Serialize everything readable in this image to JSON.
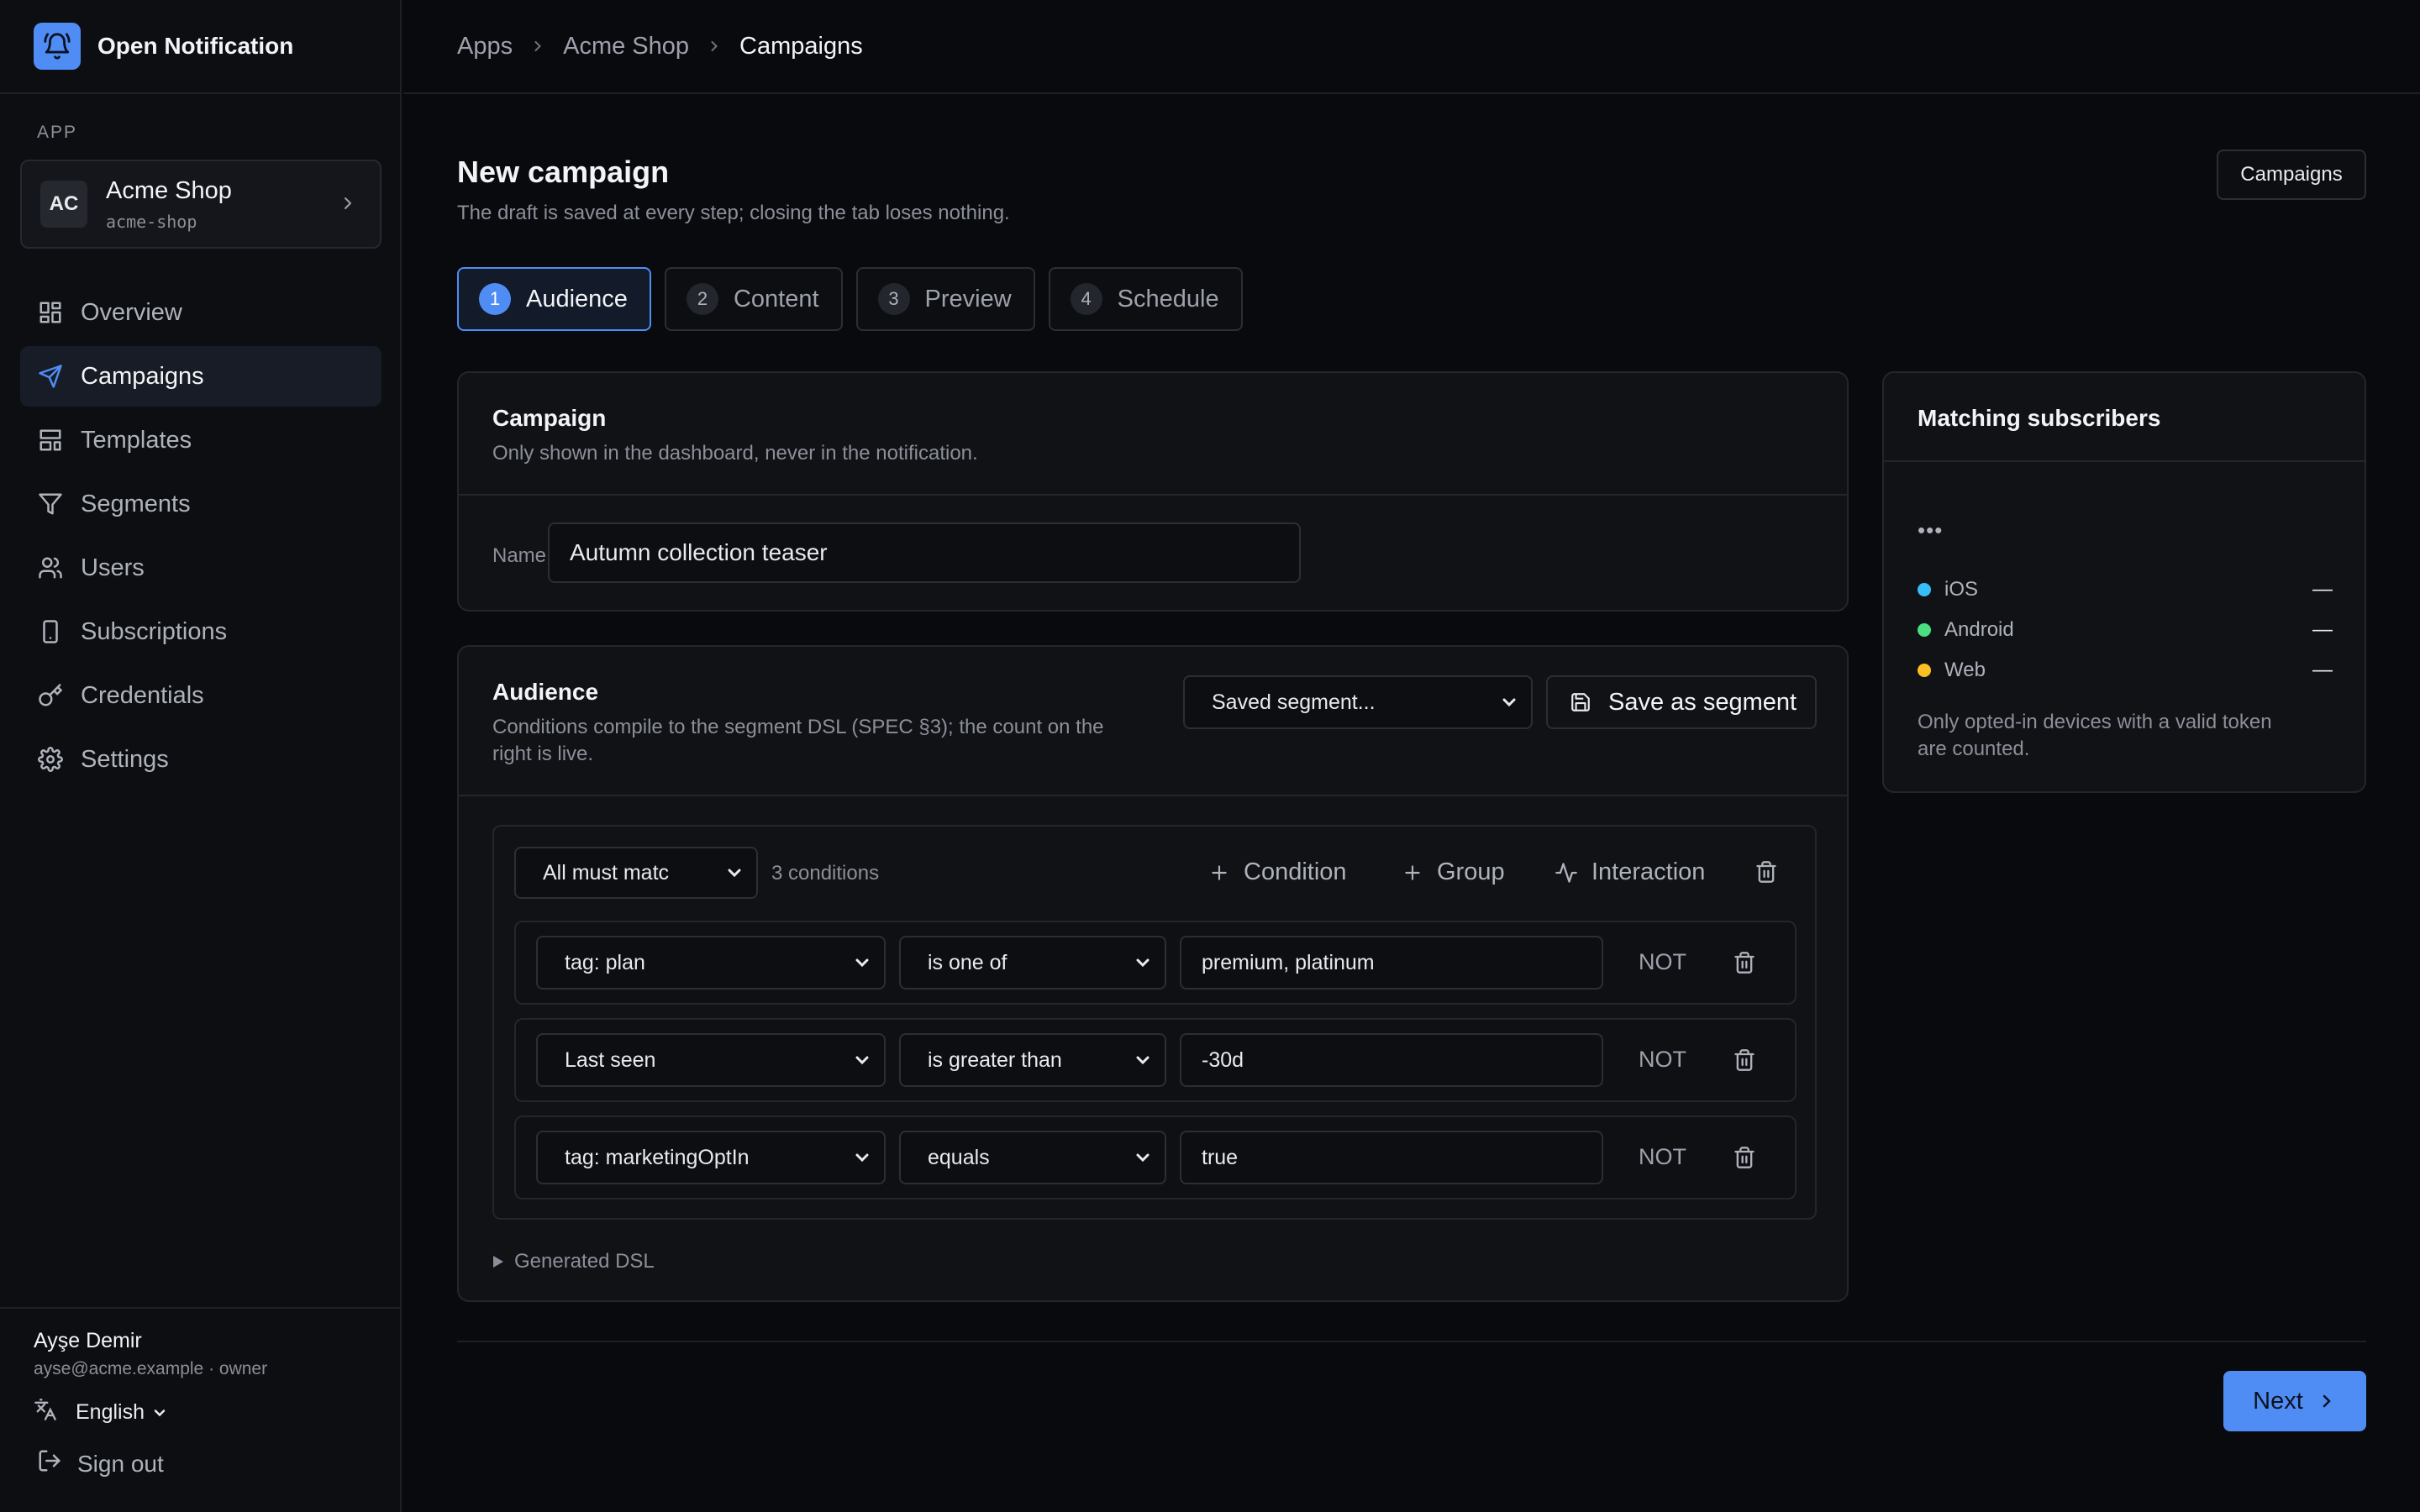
{
  "brand": {
    "name": "Open Notification",
    "icon": "bell-icon"
  },
  "sidebar": {
    "section_label": "APP",
    "app": {
      "initials": "AC",
      "name": "Acme Shop",
      "slug": "acme-shop"
    },
    "items": [
      {
        "label": "Overview",
        "icon": "grid-icon"
      },
      {
        "label": "Campaigns",
        "icon": "send-icon",
        "active": true
      },
      {
        "label": "Templates",
        "icon": "layout-icon"
      },
      {
        "label": "Segments",
        "icon": "filter-icon"
      },
      {
        "label": "Users",
        "icon": "users-icon"
      },
      {
        "label": "Subscriptions",
        "icon": "device-icon"
      },
      {
        "label": "Credentials",
        "icon": "key-icon"
      },
      {
        "label": "Settings",
        "icon": "gear-icon"
      }
    ],
    "user": {
      "name": "Ayşe Demir",
      "meta": "ayse@acme.example · owner"
    },
    "language": "English",
    "signout": "Sign out"
  },
  "breadcrumb": [
    "Apps",
    "Acme Shop",
    "Campaigns"
  ],
  "page": {
    "title": "New campaign",
    "subtitle": "The draft is saved at every step; closing the tab loses nothing.",
    "campaigns_button": "Campaigns"
  },
  "steps": [
    {
      "num": "1",
      "label": "Audience",
      "active": true
    },
    {
      "num": "2",
      "label": "Content"
    },
    {
      "num": "3",
      "label": "Preview"
    },
    {
      "num": "4",
      "label": "Schedule"
    }
  ],
  "campaign_card": {
    "title": "Campaign",
    "subtitle": "Only shown in the dashboard, never in the notification.",
    "name_label": "Name",
    "name_value": "Autumn collection teaser"
  },
  "audience_card": {
    "title": "Audience",
    "subtitle_line1": "Conditions compile to the segment DSL (SPEC §3); the count on the",
    "subtitle_line2": "right is live.",
    "saved_segment": "Saved segment...",
    "save_as_segment": "Save as segment",
    "group": {
      "match": "All must matc",
      "count": "3 conditions",
      "add_condition": "Condition",
      "add_group": "Group",
      "add_interaction": "Interaction"
    },
    "conditions": [
      {
        "field": "tag: plan",
        "operator": "is one of",
        "value": "premium, platinum",
        "not": "NOT"
      },
      {
        "field": "Last seen",
        "operator": "is greater than",
        "value": "-30d",
        "not": "NOT"
      },
      {
        "field": "tag: marketingOptIn",
        "operator": "equals",
        "value": "true",
        "not": "NOT"
      }
    ],
    "dsl_toggle": "Generated DSL"
  },
  "matching": {
    "title": "Matching subscribers",
    "loading": "•••",
    "platforms": [
      {
        "name": "iOS",
        "value": "—",
        "color": "#38bdf8"
      },
      {
        "name": "Android",
        "value": "—",
        "color": "#4ade80"
      },
      {
        "name": "Web",
        "value": "—",
        "color": "#fbbf24"
      }
    ],
    "note_line1": "Only opted-in devices with a valid token",
    "note_line2": "are counted."
  },
  "next_button": "Next",
  "colors": {
    "accent": "#4f8df5",
    "background": "#090a0d",
    "surface": "#111216"
  }
}
